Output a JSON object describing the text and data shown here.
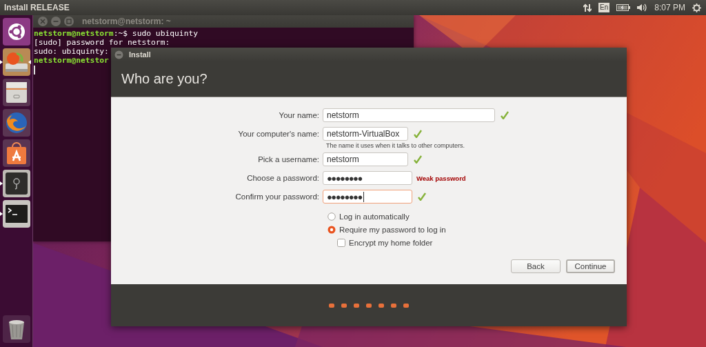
{
  "top_bar": {
    "title": "Install RELEASE",
    "keyboard_layout": "En",
    "clock": "8:07 PM"
  },
  "launcher": {
    "items": [
      {
        "kind": "ubuntu",
        "running": false,
        "focused": false
      },
      {
        "kind": "installer",
        "running": true,
        "focused": true
      },
      {
        "kind": "files",
        "running": false,
        "focused": false
      },
      {
        "kind": "browser",
        "running": false,
        "focused": false
      },
      {
        "kind": "software",
        "running": false,
        "focused": false
      },
      {
        "kind": "safe",
        "running": true,
        "focused": false
      },
      {
        "kind": "terminal",
        "running": true,
        "focused": false
      },
      {
        "kind": "trash",
        "running": false,
        "focused": false
      }
    ]
  },
  "terminal": {
    "title": "netstorm@netstorm: ~",
    "lines": [
      {
        "prompt": "netstorm@netstorm",
        "text": ":~$ sudo ubiquinty"
      },
      {
        "text": "[sudo] password for netstorm:"
      },
      {
        "text": "sudo: ubiquinty:"
      },
      {
        "prompt": "netstorm@netstor"
      }
    ]
  },
  "installer": {
    "title": "Install",
    "heading": "Who are you?",
    "fields": [
      {
        "label": "Your name:",
        "value": "netstorm",
        "valid": true,
        "focused": false
      },
      {
        "label": "Your computer's name:",
        "value": "netstorm-VirtualBox",
        "valid": true,
        "focused": false,
        "hint": "The name it uses when it talks to other computers."
      },
      {
        "label": "Pick a username:",
        "value": "netstorm",
        "valid": true,
        "focused": false
      },
      {
        "label": "Choose a password:",
        "value": "●●●●●●●●",
        "valid": false,
        "focused": false,
        "message": "Weak password"
      },
      {
        "label": "Confirm your password:",
        "value": "●●●●●●●●",
        "valid": true,
        "focused": true
      }
    ],
    "options": [
      {
        "kind": "radio",
        "label": "Log in automatically",
        "selected": false
      },
      {
        "kind": "radio",
        "label": "Require my password to log in",
        "selected": true
      },
      {
        "kind": "checkbox",
        "label": "Encrypt my home folder",
        "checked": false
      }
    ],
    "buttons": [
      {
        "label": "Back",
        "default": false
      },
      {
        "label": "Continue",
        "default": true
      }
    ]
  }
}
